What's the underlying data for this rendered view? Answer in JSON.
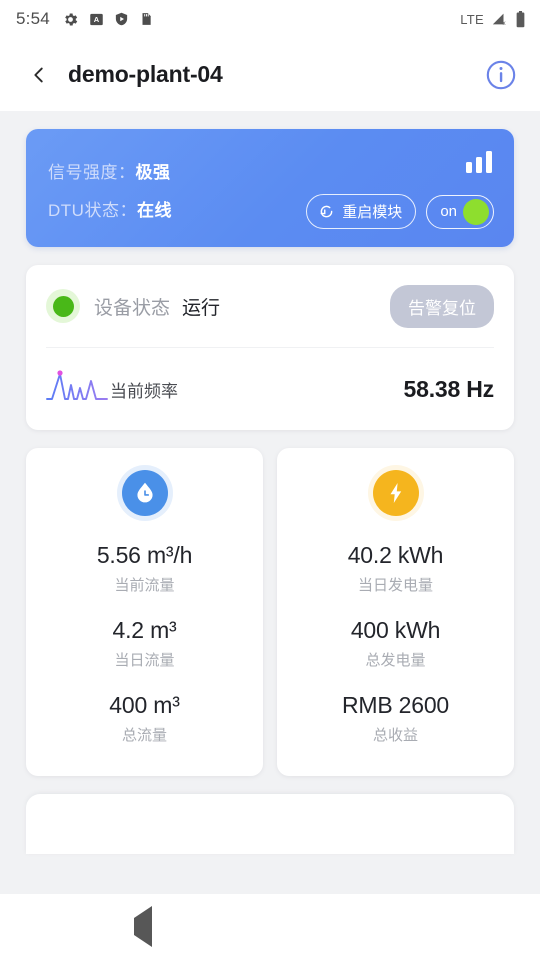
{
  "statusbar": {
    "time": "5:54",
    "left_icons": [
      "gear-icon",
      "a-badge-icon",
      "shield-play-icon",
      "sd-card-icon"
    ],
    "network_label": "LTE",
    "right_icons": [
      "cellular-signal-off-icon",
      "battery-icon"
    ]
  },
  "appbar": {
    "back_icon": "chevron-left-icon",
    "title": "demo-plant-04",
    "info_icon": "info-circle-icon"
  },
  "dtu_card": {
    "signal": {
      "label": "信号强度：",
      "value": "极强"
    },
    "dtu_state": {
      "label": "DTU状态：",
      "value": "在线"
    },
    "signal_bars_icon": "signal-bars-icon",
    "restart_button": {
      "label": "重启模块",
      "icon": "refresh-icon"
    },
    "power_toggle": {
      "label": "on",
      "state": "on"
    }
  },
  "status_card": {
    "device_status_label": "设备状态",
    "device_status_value": "运行",
    "status_dot_color": "#49b818",
    "alarm_reset_button": "告警复位",
    "frequency": {
      "icon": "waveform-icon",
      "label": "当前频率",
      "value": "58.38 Hz"
    }
  },
  "metrics": [
    {
      "icon": "water-drop-icon",
      "icon_color": "#4a90e8",
      "items": [
        {
          "value": "5.56 m³/h",
          "label": "当前流量"
        },
        {
          "value": "4.2 m³",
          "label": "当日流量"
        },
        {
          "value": "400 m³",
          "label": "总流量"
        }
      ]
    },
    {
      "icon": "lightning-bolt-icon",
      "icon_color": "#f5b51e",
      "items": [
        {
          "value": "40.2 kWh",
          "label": "当日发电量"
        },
        {
          "value": "400 kWh",
          "label": "总发电量"
        },
        {
          "value": "RMB 2600",
          "label": "总收益"
        }
      ]
    }
  ],
  "navbar": {
    "back_icon": "nav-back-icon",
    "home_icon": "nav-home-icon",
    "recents_icon": "nav-recents-icon"
  }
}
